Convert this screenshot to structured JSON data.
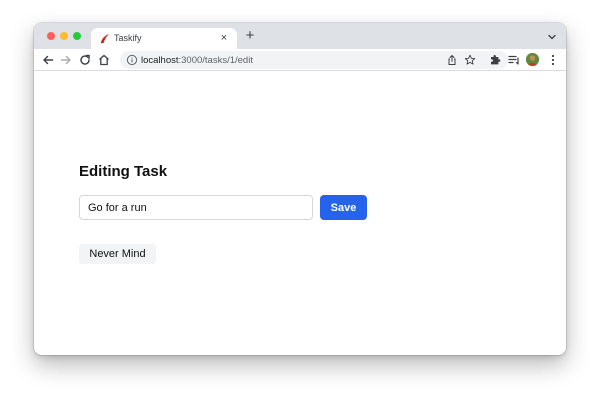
{
  "browser": {
    "tab_title": "Taskify",
    "tab_close": "×",
    "new_tab": "+",
    "url_host": "localhost",
    "url_path": ":3000/tasks/1/edit",
    "icons": [
      "back-icon",
      "forward-icon",
      "reload-icon",
      "home-icon",
      "info-icon",
      "share-icon",
      "bookmark-star-icon",
      "extensions-icon",
      "reading-list-icon",
      "profile-avatar",
      "menu-icon"
    ]
  },
  "page": {
    "title": "Editing Task",
    "task_value": "Go for a run",
    "save_label": "Save",
    "cancel_label": "Never Mind"
  },
  "colors": {
    "accent": "#2563eb",
    "secondary_button": "#f3f4f6"
  }
}
